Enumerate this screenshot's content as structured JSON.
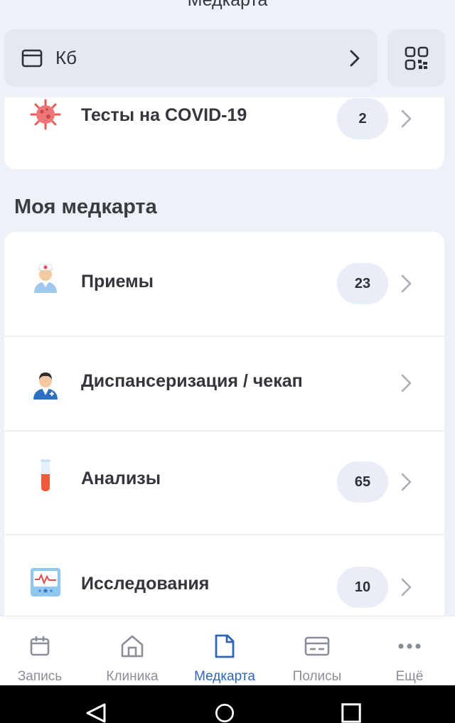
{
  "header": {
    "title": "Медкарта"
  },
  "selector": {
    "label": "Кб"
  },
  "covid": {
    "title": "Тесты на COVID-19",
    "count": "2"
  },
  "section": {
    "title": "Моя медкарта"
  },
  "items": [
    {
      "title": "Приемы",
      "count": "23",
      "icon": "doctor-icon"
    },
    {
      "title": "Диспансеризация / чекап",
      "count": "",
      "icon": "checkup-icon"
    },
    {
      "title": "Анализы",
      "count": "65",
      "icon": "test-tube-icon"
    },
    {
      "title": "Исследования",
      "count": "10",
      "icon": "monitor-icon"
    }
  ],
  "tabs": [
    {
      "label": "Запись",
      "icon": "calendar-icon"
    },
    {
      "label": "Клиника",
      "icon": "home-icon"
    },
    {
      "label": "Медкарта",
      "icon": "document-icon",
      "active": true
    },
    {
      "label": "Полисы",
      "icon": "card-icon"
    },
    {
      "label": "Ещё",
      "icon": "more-icon"
    }
  ],
  "colors": {
    "accent": "#2f67b8",
    "background": "#eef1f8",
    "inactive": "#8a8e96"
  }
}
